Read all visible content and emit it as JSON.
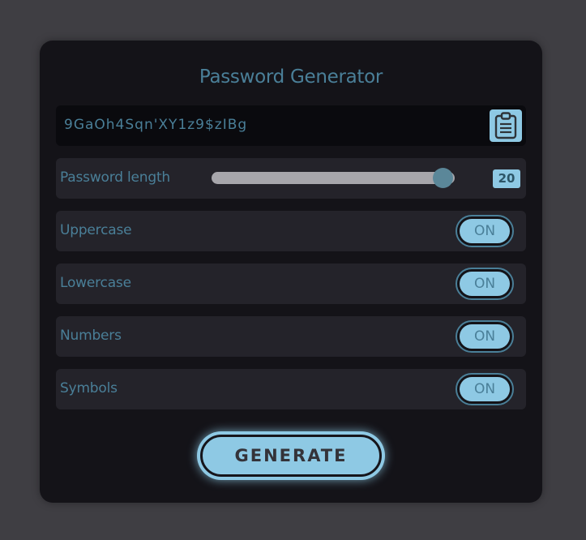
{
  "app": {
    "title": "Password Generator"
  },
  "password": {
    "value": "9GaOh4Sqn'XY1z9$zIBg",
    "copy_icon": "clipboard-icon"
  },
  "length": {
    "label": "Password length",
    "value": "20",
    "fraction": 0.95
  },
  "options": [
    {
      "label": "Uppercase",
      "state": "ON"
    },
    {
      "label": "Lowercase",
      "state": "ON"
    },
    {
      "label": "Numbers",
      "state": "ON"
    },
    {
      "label": "Symbols",
      "state": "ON"
    }
  ],
  "generate": {
    "label": "GENERATE"
  },
  "colors": {
    "accent": "#8ec9e4",
    "text": "#4a7f98",
    "card": "#141318",
    "row": "#24232a",
    "page": "#3f3e43"
  }
}
